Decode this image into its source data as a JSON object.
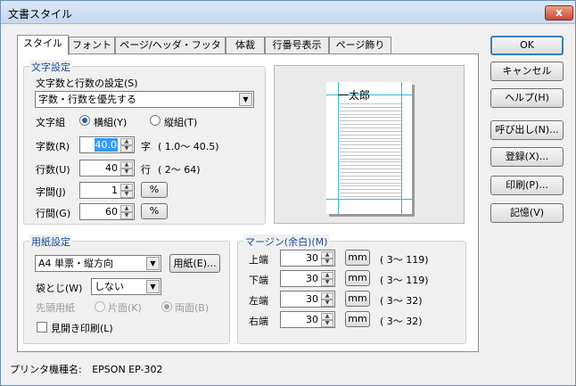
{
  "window": {
    "title": "文書スタイル",
    "close_label": "x"
  },
  "tabs": [
    "スタイル",
    "フォント",
    "ページ/ヘッダ・フッタ",
    "体裁",
    "行番号表示",
    "ページ飾り"
  ],
  "text_settings": {
    "group_title": "文字設定",
    "chars_lines_label": "文字数と行数の設定(S)",
    "chars_lines_value": "字数・行数を優先する",
    "orientation_label": "文字組",
    "horizontal_label": "横組(Y)",
    "vertical_label": "縦組(T)",
    "chars_label": "字数(R)",
    "chars_value": "40.0",
    "chars_unit": "字",
    "chars_range": "(    1.0〜    40.5)",
    "lines_label": "行数(U)",
    "lines_value": "40",
    "lines_unit": "行",
    "lines_range": "(      2〜      64)",
    "char_spacing_label": "字間(J)",
    "char_spacing_value": "1",
    "line_spacing_label": "行間(G)",
    "line_spacing_value": "60",
    "percent_label": "%"
  },
  "preview": {
    "sample_text": "一太郎",
    "guide_color": "#39b6d6",
    "lines_shown": 28
  },
  "paper": {
    "group_title": "用紙設定",
    "size_value": "A4 単票・縦方向",
    "paper_button": "用紙(E)...",
    "binding_label": "袋とじ(W)",
    "binding_value": "しない",
    "first_sheet_label": "先頭用紙",
    "one_side_label": "片面(K)",
    "both_sides_label": "両面(B)",
    "spread_print_label": "見開き印刷(L)"
  },
  "margins": {
    "group_title": "マージン(余白)(M)",
    "unit": "mm",
    "rows": [
      {
        "label": "上端",
        "value": "30",
        "range": "(      3〜    119)"
      },
      {
        "label": "下端",
        "value": "30",
        "range": "(      3〜    119)"
      },
      {
        "label": "左端",
        "value": "30",
        "range": "(      3〜      32)"
      },
      {
        "label": "右端",
        "value": "30",
        "range": "(      3〜      32)"
      }
    ]
  },
  "buttons": {
    "ok": "OK",
    "cancel": "キャンセル",
    "help": "ヘルプ(H)",
    "recall": "呼び出し(N)...",
    "register": "登録(X)...",
    "print": "印刷(P)...",
    "memory": "記憶(V)"
  },
  "status": {
    "printer_label": "プリンタ機種名:",
    "printer_value": "EPSON EP-302"
  }
}
